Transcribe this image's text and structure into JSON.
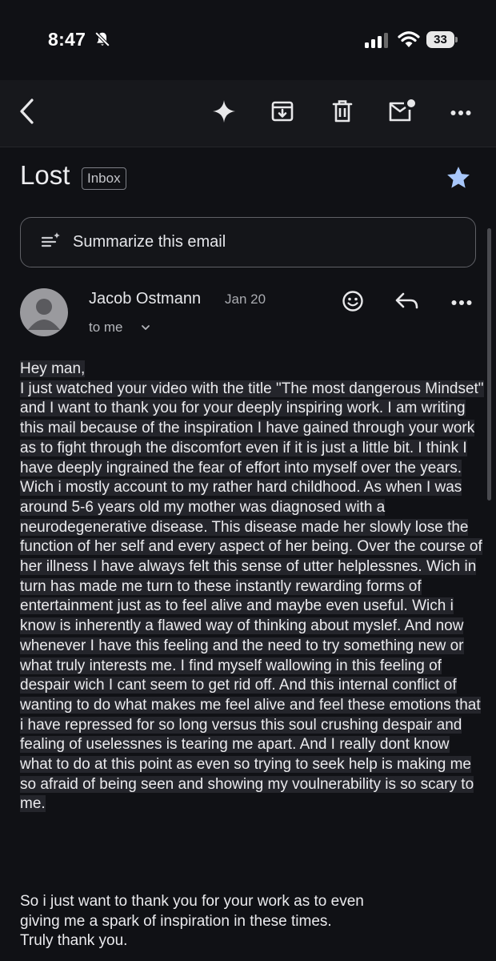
{
  "status_bar": {
    "time": "8:47",
    "battery": "33"
  },
  "toolbar": {
    "icons": [
      "back-arrow-icon",
      "sparkle-icon",
      "archive-icon",
      "trash-icon",
      "mark-unread-icon",
      "more-icon"
    ]
  },
  "email": {
    "subject": "Lost",
    "label": "Inbox",
    "starred": true,
    "summarize_label": "Summarize this email",
    "sender": "Jacob Ostmann",
    "date": "Jan 20",
    "recipient": "to me",
    "greeting": "Hey man,",
    "body": "I just watched your video with the title \"The most dangerous Mindset\" and I want to thank you for your deeply inspiring work. I am writing this mail because of the inspiration I have gained through your work as to fight through the discomfort even if it is just a little bit. I think I have deeply ingrained the fear of effort into myself over the years. Wich i mostly account to my rather hard childhood. As when I was around 5-6 years old my mother was diagnosed with a neurodegenerative disease. This disease made her slowly lose the function of her self and every aspect of her being. Over the course of her illness I have always felt this sense of utter helplessnes. Wich in turn has made me turn to these instantly rewarding forms of entertainment just as to feel alive and maybe even useful. Wich i know is inherently a flawed way of thinking about myslef. And now whenever I have this feeling and the need to try something new or what truly interests me. I find myself wallowing in this feeling of despair wich I cant seem to get rid off. And this internal conflict of wanting to do what makes me feel alive and feel these emotions that i have repressed for so long versus this soul crushing despair and fealing of uselessnes is tearing me apart. And I really dont know what to do at this point as even so trying to seek help is making me so afraid of being seen and showing my voulnerability is so scary to me.",
    "closing_line_1": "So i just want to thank you for your work as to even",
    "closing_line_2": "giving me a spark of inspiration in these times.",
    "signoff": "Truly thank you."
  },
  "colors": {
    "background": "#101115",
    "toolbar": "#17181c",
    "star": "#a8c7fa",
    "text_highlight": "#24252b"
  }
}
